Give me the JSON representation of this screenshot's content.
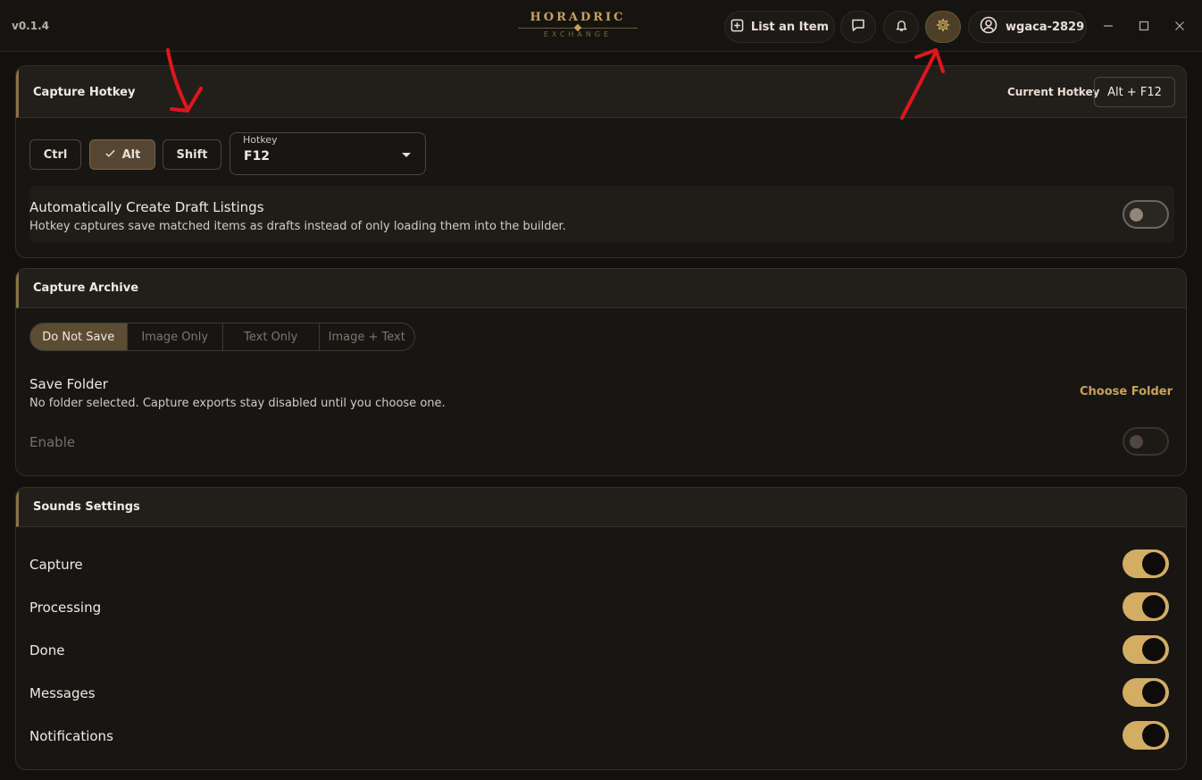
{
  "app": {
    "version": "v0.1.4",
    "logo_top": "HORADRIC",
    "logo_bottom": "EXCHANGE"
  },
  "header": {
    "list_item_label": "List an Item",
    "username": "wgaca-2829",
    "icons": [
      "plus-square-icon",
      "chat-icon",
      "bell-icon",
      "gear-icon",
      "user-circle-icon",
      "minimize-icon",
      "maximize-icon",
      "close-icon"
    ]
  },
  "capture_hotkey": {
    "title": "Capture Hotkey",
    "current_label": "Current Hotkey",
    "current_value": "Alt + F12",
    "modifiers": [
      {
        "label": "Ctrl",
        "selected": false
      },
      {
        "label": "Alt",
        "selected": true
      },
      {
        "label": "Shift",
        "selected": false
      }
    ],
    "hotkey_label": "Hotkey",
    "hotkey_value": "F12",
    "draft_title": "Automatically Create Draft Listings",
    "draft_desc": "Hotkey captures save matched items as drafts instead of only loading them into the builder.",
    "draft_enabled": false
  },
  "capture_archive": {
    "title": "Capture Archive",
    "modes": [
      "Do Not Save",
      "Image Only",
      "Text Only",
      "Image + Text"
    ],
    "selected_mode": "Do Not Save",
    "folder_title": "Save Folder",
    "folder_desc": "No folder selected. Capture exports stay disabled until you choose one.",
    "choose_folder_label": "Choose Folder",
    "enable_label": "Enable",
    "enable_on": false
  },
  "sounds": {
    "title": "Sounds Settings",
    "items": [
      {
        "label": "Capture",
        "on": true
      },
      {
        "label": "Processing",
        "on": true
      },
      {
        "label": "Done",
        "on": true
      },
      {
        "label": "Messages",
        "on": true
      },
      {
        "label": "Notifications",
        "on": true
      }
    ]
  },
  "colors": {
    "accent": "#d3ad63",
    "annotation_arrow": "#e0161e",
    "background": "#13110f"
  }
}
